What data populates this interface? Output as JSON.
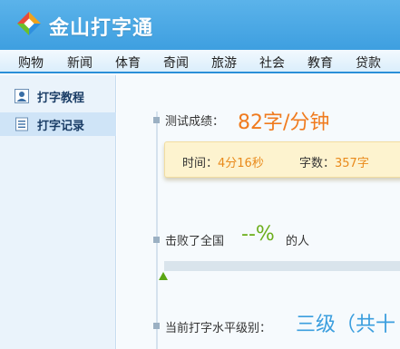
{
  "header": {
    "app_title": "金山打字通"
  },
  "nav": {
    "items": [
      "购物",
      "新闻",
      "体育",
      "奇闻",
      "旅游",
      "社会",
      "教育",
      "贷款"
    ]
  },
  "sidebar": {
    "items": [
      {
        "label": "打字教程",
        "icon": "user-icon"
      },
      {
        "label": "打字记录",
        "icon": "record-list-icon"
      }
    ],
    "active_index": 1
  },
  "result": {
    "score_label": "测试成绩：",
    "score_value": "82字/分钟",
    "time_label": "时间：",
    "time_value": "4分16秒",
    "count_label": "字数：",
    "count_value": "357字",
    "beat_label": "击败了全国",
    "beat_value": "--%",
    "beat_suffix": "的人",
    "beat_percent": 0,
    "level_label": "当前打字水平级别：",
    "level_value": "三级（共十"
  },
  "colors": {
    "header": "#3e9fe0",
    "score": "#f07b1e",
    "percent": "#6cae1c",
    "level": "#3b9ede"
  }
}
